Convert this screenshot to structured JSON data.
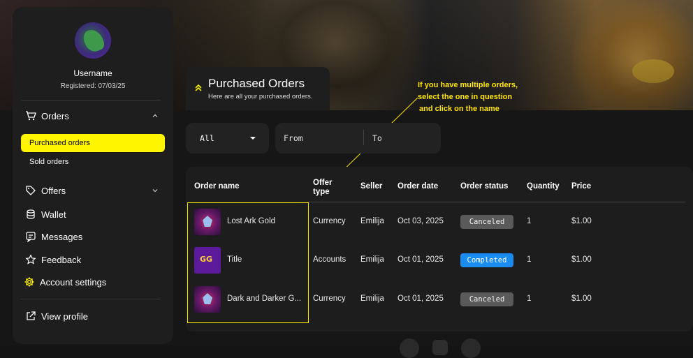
{
  "user": {
    "username": "Username",
    "registered": "Registered: 07/03/25"
  },
  "sidebar": {
    "orders_label": "Orders",
    "orders_sub": [
      "Purchased orders",
      "Sold orders"
    ],
    "items": [
      {
        "label": "Offers",
        "icon": "tag-icon"
      },
      {
        "label": "Wallet",
        "icon": "database-icon"
      },
      {
        "label": "Messages",
        "icon": "message-icon"
      },
      {
        "label": "Feedback",
        "icon": "star-icon"
      },
      {
        "label": "Account settings",
        "icon": "gear-icon"
      }
    ],
    "view_profile": "View profile"
  },
  "header": {
    "title": "Purchased Orders",
    "subtitle": "Here are all your purchased orders."
  },
  "annotation": {
    "line1": "If you have multiple orders,",
    "line2": "select the one in question",
    "line3": "and click on the name"
  },
  "filters": {
    "type_value": "All",
    "from_placeholder": "From",
    "to_placeholder": "To"
  },
  "table": {
    "columns": [
      "Order name",
      "Offer type",
      "Seller",
      "Order date",
      "Order status",
      "Quantity",
      "Price"
    ],
    "rows": [
      {
        "name": "Lost Ark Gold",
        "type": "Currency",
        "seller": "Emilija",
        "date": "Oct 03, 2025",
        "status": "Canceled",
        "quantity": "1",
        "price": "$1.00"
      },
      {
        "name": "Title",
        "type": "Accounts",
        "seller": "Emilija",
        "date": "Oct 01, 2025",
        "status": "Completed",
        "quantity": "1",
        "price": "$1.00"
      },
      {
        "name": "Dark and Darker G...",
        "type": "Currency",
        "seller": "Emilija",
        "date": "Oct 01, 2025",
        "status": "Canceled",
        "quantity": "1",
        "price": "$1.00"
      }
    ]
  },
  "colors": {
    "accent": "#fff500",
    "annotation": "#ffe500",
    "completed": "#1a8cf0",
    "canceled": "#5a5a5a"
  }
}
